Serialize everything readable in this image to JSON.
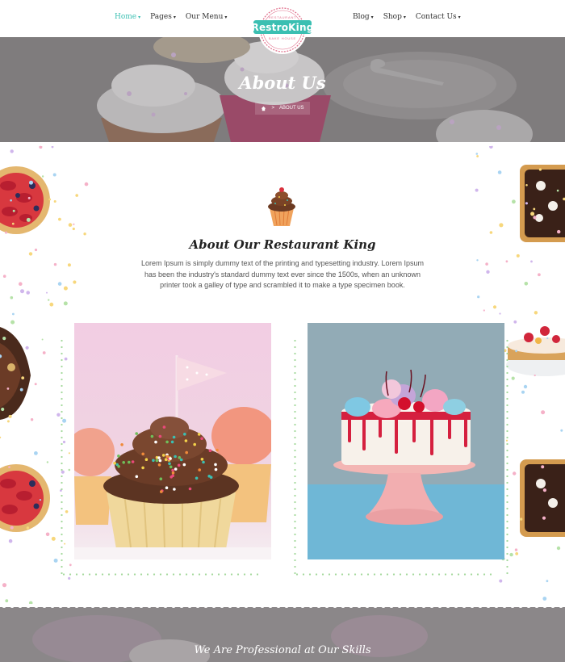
{
  "nav": {
    "left": [
      {
        "label": "Home",
        "active": true
      },
      {
        "label": "Pages",
        "active": false
      },
      {
        "label": "Our Menu",
        "active": false
      }
    ],
    "right": [
      {
        "label": "Blog",
        "active": false
      },
      {
        "label": "Shop",
        "active": false
      },
      {
        "label": "Contact Us",
        "active": false
      }
    ]
  },
  "logo": {
    "name": "RestroKing",
    "top_text": "RESTAURANT",
    "sub_text": "BAKE HOUSE",
    "colors": {
      "badge": "#3bbfb2",
      "ring": "#e06d8a"
    }
  },
  "hero": {
    "title": "About Us",
    "breadcrumb": {
      "home_icon": "home-icon",
      "separator": ">",
      "current": "ABOUT US"
    }
  },
  "about": {
    "icon": "cupcake-icon",
    "heading": "About Our Restaurant King",
    "body": "Lorem Ipsum is simply dummy text of the printing and typesetting industry. Lorem Ipsum has been the industry's standard dummy text ever since the 1500s, when an unknown printer took a galley of type and scrambled it to make a type specimen book."
  },
  "photos": [
    {
      "subject": "cupcake-with-sprinkles-photo"
    },
    {
      "subject": "drip-cake-on-stand-photo"
    }
  ],
  "bottom": {
    "title": "We Are Professional at Our Skills"
  },
  "colors": {
    "accent": "#3bbfb2",
    "hero_overlay": "#7c7a7b",
    "dots": "#a5d99d"
  }
}
